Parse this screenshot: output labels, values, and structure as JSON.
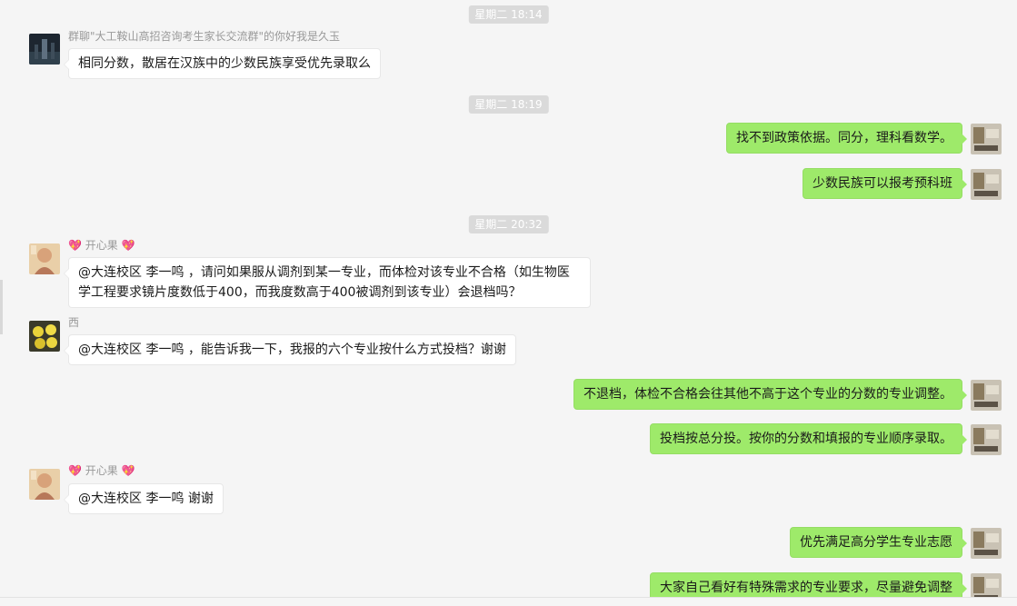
{
  "timestamps": [
    "星期二 18:14",
    "星期二 18:19",
    "星期二 20:32"
  ],
  "senders": {
    "group": "群聊\"大工鞍山高招咨询考生家长交流群\"的你好我是久玉",
    "kaixinguo": "开心果",
    "xi": "西",
    "heart_glyph": "💖"
  },
  "messages": {
    "m1": "相同分数，散居在汉族中的少数民族享受优先录取么",
    "m2": "找不到政策依据。同分，理科看数学。",
    "m3": "少数民族可以报考预科班",
    "m4": "@大连校区 李一鸣 ，请问如果服从调剂到某一专业，而体检对该专业不合格（如生物医学工程要求镜片度数低于400，而我度数高于400被调剂到该专业）会退档吗？",
    "m5": "@大连校区 李一鸣 ，能告诉我一下，我报的六个专业按什么方式投档？谢谢",
    "m6": "不退档，体检不合格会往其他不高于这个专业的分数的专业调整。",
    "m7": "投档按总分投。按你的分数和填报的专业顺序录取。",
    "m8": "@大连校区 李一鸣 谢谢",
    "m9": "优先满足高分学生专业志愿",
    "m10": "大家自己看好有特殊需求的专业要求，尽量避免调整"
  },
  "colors": {
    "outgoing_bubble": "#9eea6a",
    "incoming_bubble": "#ffffff",
    "timestamp_bg": "#dadada",
    "background": "#f5f5f5"
  }
}
